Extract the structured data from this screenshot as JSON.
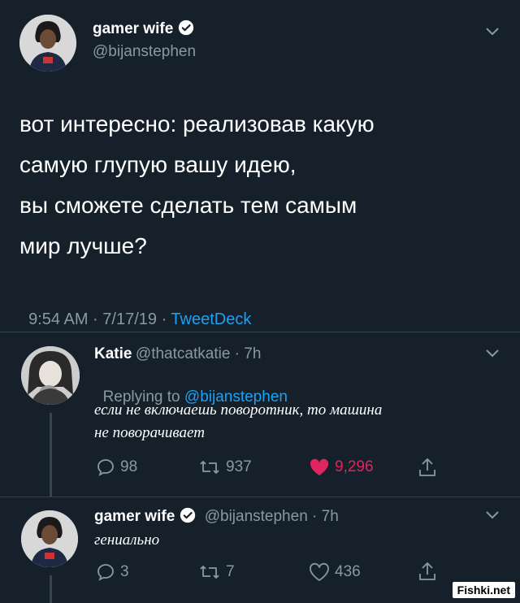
{
  "main_tweet": {
    "display_name": "gamer wife",
    "handle": "@bijanstephen",
    "text_lines": [
      "вот интересно: реализовав какую",
      "самую глупую вашу идею,",
      "вы сможете сделать тем самым",
      "мир лучше?"
    ],
    "time": "9:54 AM · 7/17/19 · ",
    "source": "TweetDeck"
  },
  "reply1": {
    "display_name": "Katie",
    "handle_time": "@thatcatkatie · 7h",
    "replying_prefix": "Replying to ",
    "replying_handle": "@bijanstephen",
    "text_lines": [
      "если не включаешь поворотник, то машина",
      "не поворачивает"
    ],
    "replies": "98",
    "retweets": "937",
    "likes": "9,296"
  },
  "reply2": {
    "display_name": "gamer wife",
    "handle_time": "@bijanstephen · 7h",
    "text": "гениально",
    "replies": "3",
    "retweets": "7",
    "likes": "436"
  },
  "watermark": "Fishki.net",
  "colors": {
    "background": "#15202b",
    "link": "#1da1f2",
    "muted": "#8899a6",
    "like_active": "#e0245e"
  }
}
